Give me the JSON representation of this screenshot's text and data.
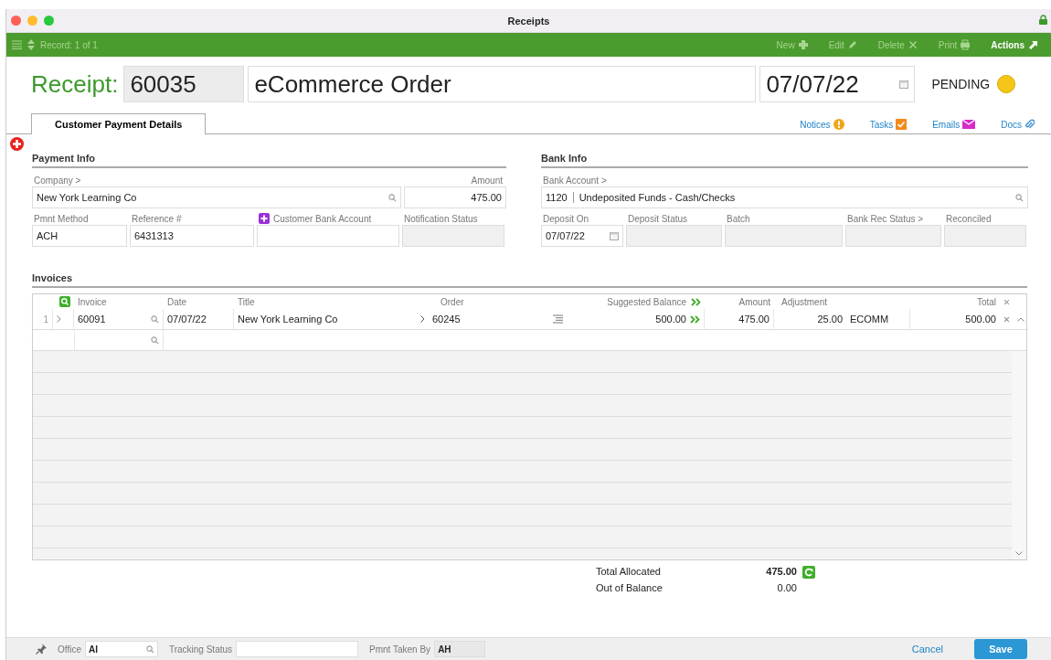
{
  "window": {
    "title": "Receipts"
  },
  "toolbar": {
    "record": "Record: 1 of 1",
    "actions": [
      {
        "label": "New",
        "kind": "new",
        "disabled": true
      },
      {
        "label": "Edit",
        "kind": "edit",
        "disabled": true
      },
      {
        "label": "Delete",
        "kind": "delete",
        "disabled": true
      },
      {
        "label": "Print",
        "kind": "print",
        "disabled": true
      },
      {
        "label": "Actions",
        "kind": "actions",
        "disabled": false
      }
    ]
  },
  "header": {
    "label": "Receipt:",
    "number": "60035",
    "title": "eCommerce Order",
    "date": "07/07/22",
    "status": {
      "label": "PENDING",
      "color": "#f5c518"
    }
  },
  "tabs": [
    {
      "label": "Customer Payment Details",
      "selected": true
    }
  ],
  "links": [
    {
      "label": "Notices",
      "kind": "notices"
    },
    {
      "label": "Tasks",
      "kind": "tasks"
    },
    {
      "label": "Emails",
      "kind": "emails"
    },
    {
      "label": "Docs",
      "kind": "docs"
    }
  ],
  "sections": [
    {
      "title": "Payment Info",
      "rows": [
        [
          {
            "label": "Company >",
            "value": "New York Learning Co",
            "kind": "lookup",
            "readonly": false
          },
          {
            "label": "Amount",
            "value": "475.00",
            "kind": "number",
            "readonly": false
          }
        ],
        [
          {
            "label": "Pmnt Method",
            "value": "ACH",
            "kind": "text",
            "readonly": false
          },
          {
            "label": "Reference #",
            "value": "6431313",
            "kind": "text",
            "readonly": false
          },
          {
            "label": "Customer Bank Account",
            "kind": "add",
            "readonly": false
          },
          {
            "label": "Notification Status",
            "kind": "text",
            "readonly": true
          }
        ]
      ]
    },
    {
      "title": "Bank Info",
      "rows": [
        [
          {
            "label": "Bank Account >",
            "code": "1120",
            "value": "Undeposited Funds - Cash/Checks",
            "kind": "lookup",
            "readonly": false
          }
        ],
        [
          {
            "label": "Deposit On",
            "value": "07/07/22",
            "kind": "date",
            "readonly": false
          },
          {
            "label": "Deposit Status",
            "kind": "text",
            "readonly": true
          },
          {
            "label": "Batch",
            "kind": "text",
            "readonly": true
          },
          {
            "label": "Bank Rec Status >",
            "kind": "text",
            "readonly": true
          },
          {
            "label": "Reconciled",
            "kind": "text",
            "readonly": true
          }
        ]
      ]
    }
  ],
  "invoices": {
    "title": "Invoices",
    "columns": [
      "Invoice",
      "Date",
      "Title",
      "Order",
      "Suggested Balance",
      "Amount",
      "Adjustment",
      "Total"
    ],
    "rows": [
      {
        "line": "1",
        "invoice": "60091",
        "date": "07/07/22",
        "title": "New York Learning Co",
        "order": "60245",
        "suggested_balance": "500.00",
        "amount": "475.00",
        "adjustment": "25.00",
        "code": "ECOMM",
        "total": "500.00"
      }
    ]
  },
  "totals": [
    {
      "label": "Total Allocated",
      "value": "475.00",
      "kind": "allocated"
    },
    {
      "label": "Out of Balance",
      "value": "0.00",
      "kind": "balance"
    }
  ],
  "footer": {
    "fields": [
      {
        "label": "Office",
        "value": "AI",
        "kind": "lookup",
        "readonly": false
      },
      {
        "label": "Tracking Status",
        "kind": "text",
        "readonly": false
      },
      {
        "label": "Pmnt Taken By",
        "value": "AH",
        "kind": "text",
        "readonly": true
      }
    ],
    "cancel": "Cancel",
    "save": "Save"
  }
}
